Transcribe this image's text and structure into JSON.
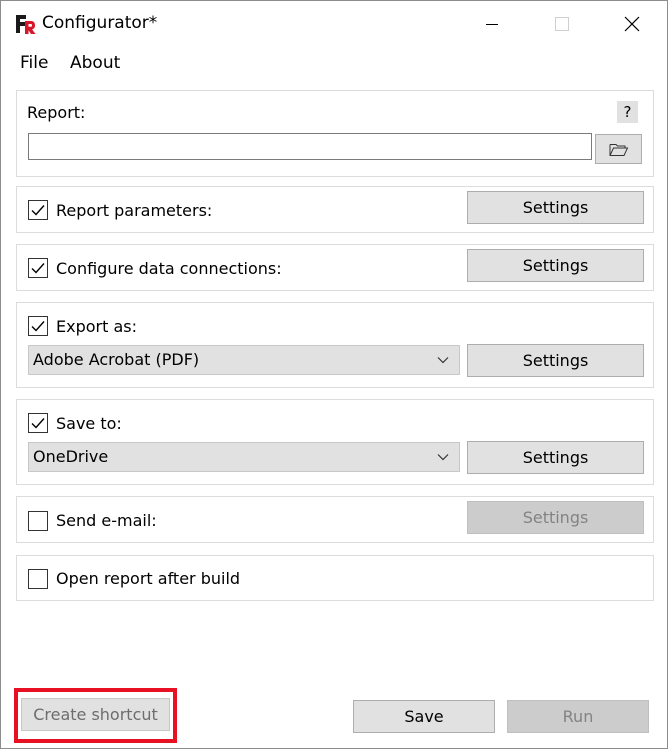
{
  "window": {
    "title": "Configurator*",
    "app_icon": "fastreport-logo-icon",
    "controls": [
      "minimize-icon",
      "maximize-icon",
      "close-icon"
    ]
  },
  "menu": {
    "file": "File",
    "about": "About"
  },
  "report": {
    "label": "Report:",
    "help_label": "?",
    "path_value": "",
    "browse_icon": "folder-open-icon"
  },
  "params": {
    "label": "Report parameters:",
    "checked": true,
    "settings_label": "Settings"
  },
  "connections": {
    "label": "Configure data connections:",
    "checked": true,
    "settings_label": "Settings"
  },
  "export": {
    "label": "Export as:",
    "checked": true,
    "selected": "Adobe Acrobat (PDF)",
    "settings_label": "Settings"
  },
  "save_to": {
    "label": "Save to:",
    "checked": true,
    "selected": "OneDrive",
    "settings_label": "Settings"
  },
  "email": {
    "label": "Send e-mail:",
    "checked": false,
    "settings_label": "Settings",
    "settings_enabled": false
  },
  "open_after": {
    "label": "Open report after build",
    "checked": false
  },
  "footer": {
    "create_shortcut_label": "Create shortcut",
    "save_label": "Save",
    "run_label": "Run",
    "highlight_color": "#e81123"
  }
}
